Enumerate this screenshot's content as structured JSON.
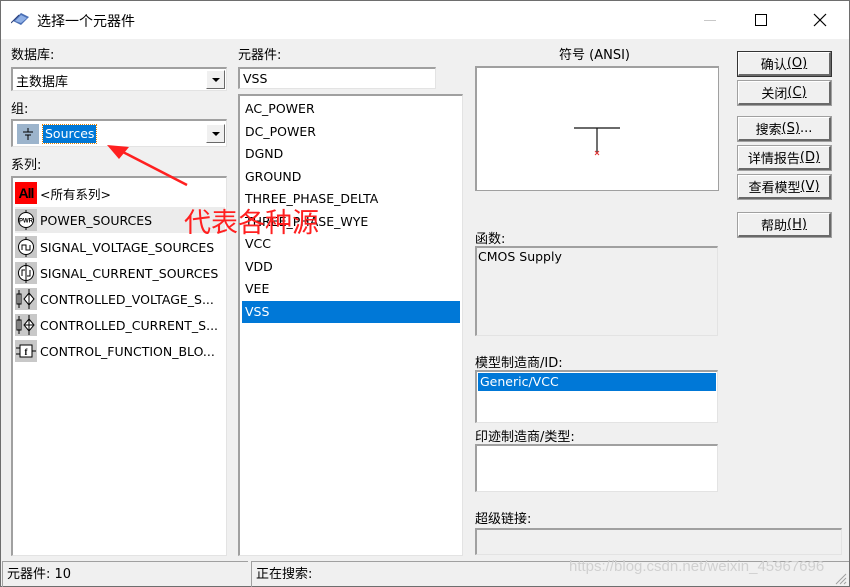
{
  "window": {
    "title": "选择一个元器件",
    "icon": "multisim-app-icon"
  },
  "left": {
    "database_label": "数据库:",
    "database_value": "主数据库",
    "group_label": "组:",
    "group_value": "Sources",
    "series_label": "系列:",
    "series": [
      {
        "label": "<所有系列>",
        "icon": "all-icon"
      },
      {
        "label": "POWER_SOURCES",
        "icon": "power-source-icon"
      },
      {
        "label": "SIGNAL_VOLTAGE_SOURCES",
        "icon": "signal-voltage-icon"
      },
      {
        "label": "SIGNAL_CURRENT_SOURCES",
        "icon": "signal-current-icon"
      },
      {
        "label": "CONTROLLED_VOLTAGE_S...",
        "icon": "controlled-voltage-icon"
      },
      {
        "label": "CONTROLLED_CURRENT_S...",
        "icon": "controlled-current-icon"
      },
      {
        "label": "CONTROL_FUNCTION_BLO...",
        "icon": "function-block-icon"
      }
    ],
    "all_icon_text": "All"
  },
  "middle": {
    "component_label": "元器件:",
    "component_value": "VSS",
    "components": [
      "AC_POWER",
      "DC_POWER",
      "DGND",
      "GROUND",
      "THREE_PHASE_DELTA",
      "THREE_PHASE_WYE",
      "VCC",
      "VDD",
      "VEE",
      "VSS"
    ],
    "selected_index": 9
  },
  "right": {
    "symbol_label": "符号 (ANSI)",
    "function_label": "函数:",
    "function_value": "CMOS Supply",
    "model_label": "模型制造商/ID:",
    "model_value": "Generic/VCC",
    "footprint_label": "印迹制造商/类型:",
    "hyperlink_label": "超级链接:"
  },
  "buttons": {
    "ok": {
      "text": "确认",
      "key": "(O)"
    },
    "close": {
      "text": "关闭",
      "key": "(C)"
    },
    "search": {
      "text": "搜索",
      "key": "(S)",
      "suffix": "..."
    },
    "detail": {
      "text": "详情报告",
      "key": "(D)"
    },
    "model": {
      "text": "查看模型",
      "key": "(V)"
    },
    "help": {
      "text": "帮助",
      "key": "(H)"
    }
  },
  "status": {
    "count": "元器件:  10",
    "searching": "正在搜索:"
  },
  "annotation": {
    "text": "代表各种源",
    "color": "#ff2020"
  },
  "watermark": "https://blog.csdn.net/weixin_45967696",
  "colors": {
    "selection": "#0078d7",
    "dialog_bg": "#f0f0f0"
  }
}
